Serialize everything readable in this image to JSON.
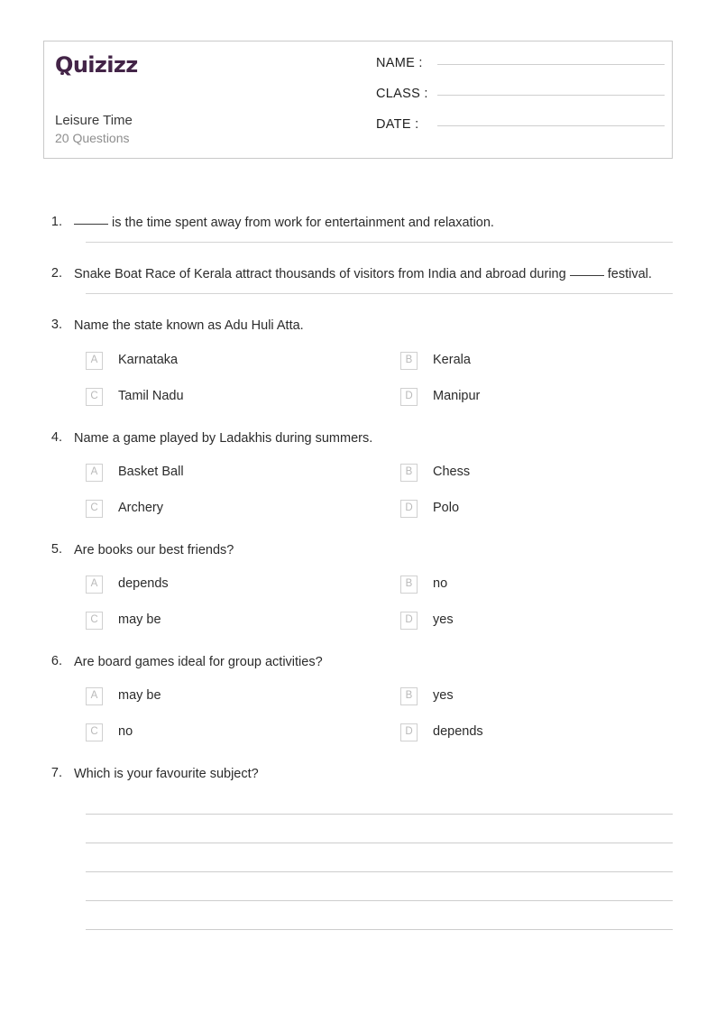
{
  "header": {
    "logo_text": "Quizizz",
    "logo_icon": "quizizz-logo",
    "logo_color": "#432447",
    "quiz_title": "Leisure Time",
    "question_count": "20 Questions",
    "fields": [
      {
        "label": "NAME :"
      },
      {
        "label": "CLASS :"
      },
      {
        "label": "DATE  :"
      }
    ]
  },
  "questions": [
    {
      "number": "1.",
      "pre_blank": true,
      "text": " is the time spent away from work for entertainment and relaxation.",
      "type": "fill-in-the-blank",
      "options": []
    },
    {
      "number": "2.",
      "pre_blank": false,
      "text_part1": "Snake Boat Race of Kerala attract thousands of visitors from India and abroad during",
      "text_part2": " festival.",
      "type": "fill-in-the-blank-inline",
      "options": []
    },
    {
      "number": "3.",
      "text": "Name the state known as Adu Huli Atta.",
      "type": "multiple-choice",
      "options": [
        {
          "letter": "A",
          "text": "Karnataka"
        },
        {
          "letter": "B",
          "text": "Kerala"
        },
        {
          "letter": "C",
          "text": "Tamil Nadu"
        },
        {
          "letter": "D",
          "text": "Manipur"
        }
      ]
    },
    {
      "number": "4.",
      "text": "Name a game played by Ladakhis during summers.",
      "type": "multiple-choice",
      "options": [
        {
          "letter": "A",
          "text": "Basket Ball"
        },
        {
          "letter": "B",
          "text": "Chess"
        },
        {
          "letter": "C",
          "text": "Archery"
        },
        {
          "letter": "D",
          "text": "Polo"
        }
      ]
    },
    {
      "number": "5.",
      "text": "Are books our best friends?",
      "type": "multiple-choice",
      "options": [
        {
          "letter": "A",
          "text": "depends"
        },
        {
          "letter": "B",
          "text": "no"
        },
        {
          "letter": "C",
          "text": "may be"
        },
        {
          "letter": "D",
          "text": "yes"
        }
      ]
    },
    {
      "number": "6.",
      "text": "Are board games ideal for group activities?",
      "type": "multiple-choice",
      "options": [
        {
          "letter": "A",
          "text": "may be"
        },
        {
          "letter": "B",
          "text": "yes"
        },
        {
          "letter": "C",
          "text": "no"
        },
        {
          "letter": "D",
          "text": "depends"
        }
      ]
    },
    {
      "number": "7.",
      "text": "Which is your favourite subject?",
      "type": "open-response",
      "answer_lines": 5,
      "options": []
    }
  ]
}
